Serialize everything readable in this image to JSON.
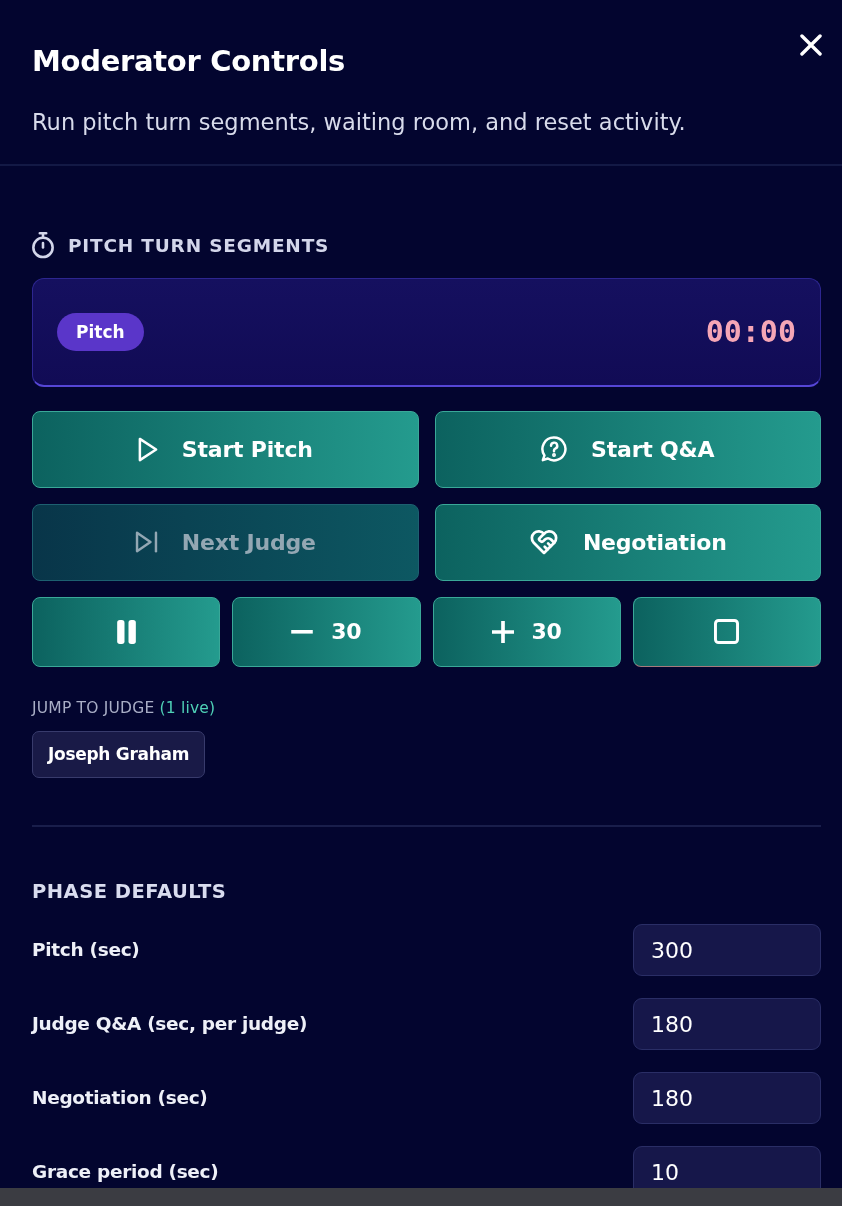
{
  "dialog": {
    "title": "Moderator Controls",
    "subtitle": "Run pitch turn segments, waiting room, and reset activity."
  },
  "segments": {
    "heading": "PITCH TURN SEGMENTS",
    "phase": "Pitch",
    "time": "00:00",
    "buttons": [
      {
        "kind": "play",
        "label": "Start Pitch",
        "disabled": false
      },
      {
        "kind": "question",
        "label": "Start Q&A",
        "disabled": false
      },
      {
        "kind": "skip",
        "label": "Next Judge",
        "disabled": true
      },
      {
        "kind": "handshake",
        "label": "Negotiation",
        "disabled": false
      }
    ],
    "controls": [
      {
        "kind": "pause",
        "disabled": false
      },
      {
        "kind": "minus",
        "label": "30",
        "disabled": false
      },
      {
        "kind": "plus",
        "label": "30",
        "disabled": false
      },
      {
        "kind": "stop",
        "disabled": false
      }
    ]
  },
  "jump_to_judge": {
    "label": "JUMP TO JUDGE",
    "live_count": "(1 live)",
    "judges": [
      {
        "name": "Joseph Graham",
        "selected": false
      }
    ]
  },
  "phase_defaults": {
    "heading": "PHASE DEFAULTS",
    "fields": [
      {
        "label": "Pitch (sec)",
        "value": "300"
      },
      {
        "label": "Judge Q&A (sec, per judge)",
        "value": "180"
      },
      {
        "label": "Negotiation (sec)",
        "value": "180"
      },
      {
        "label": "Grace period (sec)",
        "value": "10"
      }
    ]
  }
}
